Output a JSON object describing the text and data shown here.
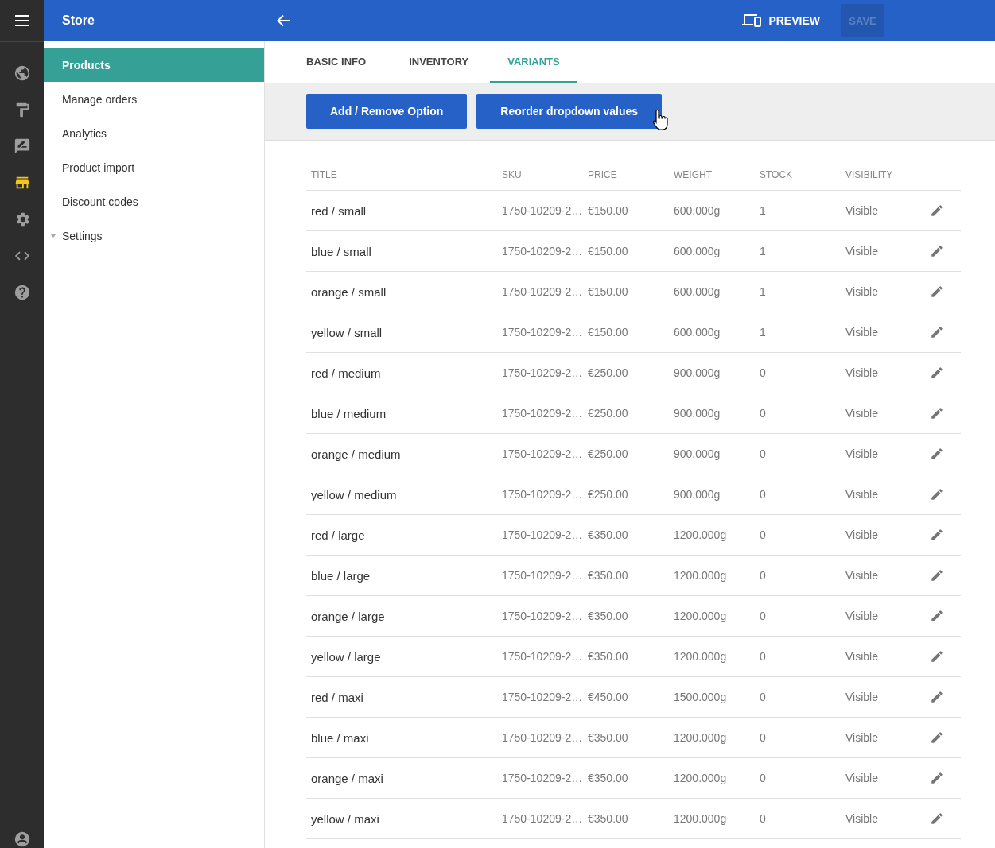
{
  "app_bar": {
    "title": "Store",
    "preview_label": "PREVIEW",
    "save": {
      "label": "SAVE",
      "disabled": true
    }
  },
  "rail": [
    {
      "kind": "globe",
      "selected": false
    },
    {
      "kind": "roller",
      "selected": false
    },
    {
      "kind": "feedback",
      "selected": false
    },
    {
      "kind": "store",
      "selected": true
    },
    {
      "kind": "gear",
      "selected": false
    },
    {
      "kind": "code",
      "selected": false
    },
    {
      "kind": "help",
      "selected": false
    }
  ],
  "sidebar": {
    "items": [
      {
        "label": "Products",
        "selected": true
      },
      {
        "label": "Manage orders",
        "selected": false
      },
      {
        "label": "Analytics",
        "selected": false
      },
      {
        "label": "Product import",
        "selected": false
      },
      {
        "label": "Discount codes",
        "selected": false
      },
      {
        "label": "Settings",
        "selected": false,
        "expanded": false
      }
    ]
  },
  "tabs": [
    {
      "label": "BASIC INFO",
      "selected": false
    },
    {
      "label": "INVENTORY",
      "selected": false
    },
    {
      "label": "VARIANTS",
      "selected": true
    }
  ],
  "actions": [
    "Add / Remove Option",
    "Reorder dropdown values"
  ],
  "table": {
    "columns": [
      "TITLE",
      "SKU",
      "PRICE",
      "WEIGHT",
      "STOCK",
      "VISIBILITY"
    ],
    "rows": [
      [
        "red / small",
        "1750-10209-2…",
        "€150.00",
        "600.000g",
        "1",
        "Visible"
      ],
      [
        "blue / small",
        "1750-10209-2…",
        "€150.00",
        "600.000g",
        "1",
        "Visible"
      ],
      [
        "orange / small",
        "1750-10209-2…",
        "€150.00",
        "600.000g",
        "1",
        "Visible"
      ],
      [
        "yellow / small",
        "1750-10209-2…",
        "€150.00",
        "600.000g",
        "1",
        "Visible"
      ],
      [
        "red / medium",
        "1750-10209-2…",
        "€250.00",
        "900.000g",
        "0",
        "Visible"
      ],
      [
        "blue / medium",
        "1750-10209-2…",
        "€250.00",
        "900.000g",
        "0",
        "Visible"
      ],
      [
        "orange / medium",
        "1750-10209-2…",
        "€250.00",
        "900.000g",
        "0",
        "Visible"
      ],
      [
        "yellow / medium",
        "1750-10209-2…",
        "€250.00",
        "900.000g",
        "0",
        "Visible"
      ],
      [
        "red / large",
        "1750-10209-2…",
        "€350.00",
        "1200.000g",
        "0",
        "Visible"
      ],
      [
        "blue / large",
        "1750-10209-2…",
        "€350.00",
        "1200.000g",
        "0",
        "Visible"
      ],
      [
        "orange / large",
        "1750-10209-2…",
        "€350.00",
        "1200.000g",
        "0",
        "Visible"
      ],
      [
        "yellow / large",
        "1750-10209-2…",
        "€350.00",
        "1200.000g",
        "0",
        "Visible"
      ],
      [
        "red / maxi",
        "1750-10209-2…",
        "€450.00",
        "1500.000g",
        "0",
        "Visible"
      ],
      [
        "blue / maxi",
        "1750-10209-2…",
        "€350.00",
        "1200.000g",
        "0",
        "Visible"
      ],
      [
        "orange / maxi",
        "1750-10209-2…",
        "€350.00",
        "1200.000g",
        "0",
        "Visible"
      ],
      [
        "yellow / maxi",
        "1750-10209-2…",
        "€350.00",
        "1200.000g",
        "0",
        "Visible"
      ]
    ]
  }
}
